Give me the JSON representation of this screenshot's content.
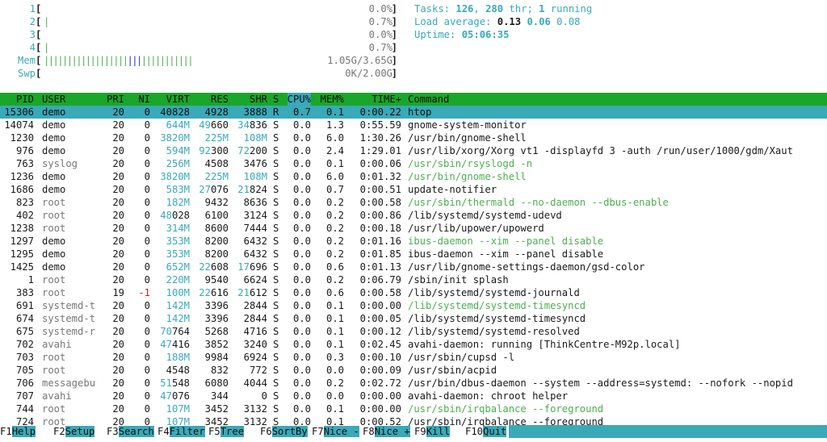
{
  "meters": [
    {
      "label": "1",
      "bars": "",
      "value": "0.0%"
    },
    {
      "label": "2",
      "bars": "|",
      "value": "0.7%"
    },
    {
      "label": "3",
      "bars": "",
      "value": "0.0%"
    },
    {
      "label": "4",
      "bars": "|",
      "value": "0.7%"
    },
    {
      "label": "Mem",
      "bars": "||||||||||||||||||||||||||||||||",
      "value": "1.05G/3.65G"
    },
    {
      "label": "Swp",
      "bars": "",
      "value": "0K/2.00G"
    }
  ],
  "stats": {
    "tasks_label": "Tasks: ",
    "tasks": "126",
    "thr": "280",
    "thr_label": " thr; ",
    "running": "1",
    "running_label": " running",
    "load_label": "Load average: ",
    "load1": "0.13",
    "load5": "0.06",
    "load15": "0.08",
    "uptime_label": "Uptime: ",
    "uptime": "05:06:35"
  },
  "columns": {
    "pid": "PID",
    "user": "USER",
    "pri": "PRI",
    "ni": "NI",
    "virt": "VIRT",
    "res": "RES",
    "shr": "SHR",
    "s": "S",
    "cpu": "CPU%",
    "mem": "MEM%",
    "time": "TIME+",
    "cmd": "Command"
  },
  "processes": [
    {
      "pid": "15306",
      "user": "demo",
      "pri": "20",
      "ni": "0",
      "virt": "40828",
      "res": "4928",
      "shr": "3888",
      "s": "R",
      "cpu": "0.7",
      "mem": "0.1",
      "time": "0:00.22",
      "cmd": "htop",
      "selected": true
    },
    {
      "pid": "14074",
      "user": "demo",
      "pri": "20",
      "ni": "0",
      "virt": "644M",
      "res": "49660",
      "shr": "34836",
      "s": "S",
      "cpu": "0.0",
      "mem": "1.3",
      "time": "0:55.59",
      "cmd": "gnome-system-monitor"
    },
    {
      "pid": "1230",
      "user": "demo",
      "pri": "20",
      "ni": "0",
      "virt": "3820M",
      "res": "225M",
      "shr": "108M",
      "s": "S",
      "cpu": "0.0",
      "mem": "6.0",
      "time": "1:30.26",
      "cmd": "/usr/bin/gnome-shell"
    },
    {
      "pid": "976",
      "user": "demo",
      "pri": "20",
      "ni": "0",
      "virt": "594M",
      "res": "92300",
      "shr": "72200",
      "s": "S",
      "cpu": "0.0",
      "mem": "2.4",
      "time": "1:29.01",
      "cmd": "/usr/lib/xorg/Xorg vt1 -displayfd 3 -auth /run/user/1000/gdm/Xaut"
    },
    {
      "pid": "763",
      "user": "syslog",
      "pri": "20",
      "ni": "0",
      "virt": "256M",
      "res": "4508",
      "shr": "3476",
      "s": "S",
      "cpu": "0.0",
      "mem": "0.1",
      "time": "0:00.06",
      "cmd": "/usr/sbin/rsyslogd -n",
      "thread": true
    },
    {
      "pid": "1236",
      "user": "demo",
      "pri": "20",
      "ni": "0",
      "virt": "3820M",
      "res": "225M",
      "shr": "108M",
      "s": "S",
      "cpu": "0.0",
      "mem": "6.0",
      "time": "0:01.32",
      "cmd": "/usr/bin/gnome-shell",
      "thread": true
    },
    {
      "pid": "1686",
      "user": "demo",
      "pri": "20",
      "ni": "0",
      "virt": "583M",
      "res": "27076",
      "shr": "21824",
      "s": "S",
      "cpu": "0.0",
      "mem": "0.7",
      "time": "0:00.51",
      "cmd": "update-notifier"
    },
    {
      "pid": "823",
      "user": "root",
      "pri": "20",
      "ni": "0",
      "virt": "182M",
      "res": "9432",
      "shr": "8636",
      "s": "S",
      "cpu": "0.0",
      "mem": "0.2",
      "time": "0:00.58",
      "cmd": "/usr/sbin/thermald --no-daemon --dbus-enable",
      "thread": true
    },
    {
      "pid": "402",
      "user": "root",
      "pri": "20",
      "ni": "0",
      "virt": "48028",
      "res": "6100",
      "shr": "3124",
      "s": "S",
      "cpu": "0.0",
      "mem": "0.2",
      "time": "0:00.86",
      "cmd": "/lib/systemd/systemd-udevd"
    },
    {
      "pid": "1238",
      "user": "root",
      "pri": "20",
      "ni": "0",
      "virt": "314M",
      "res": "8600",
      "shr": "7444",
      "s": "S",
      "cpu": "0.0",
      "mem": "0.2",
      "time": "0:00.18",
      "cmd": "/usr/lib/upower/upowerd"
    },
    {
      "pid": "1297",
      "user": "demo",
      "pri": "20",
      "ni": "0",
      "virt": "353M",
      "res": "8200",
      "shr": "6432",
      "s": "S",
      "cpu": "0.0",
      "mem": "0.2",
      "time": "0:01.16",
      "cmd": "ibus-daemon --xim --panel disable",
      "thread": true
    },
    {
      "pid": "1295",
      "user": "demo",
      "pri": "20",
      "ni": "0",
      "virt": "353M",
      "res": "8200",
      "shr": "6432",
      "s": "S",
      "cpu": "0.0",
      "mem": "0.2",
      "time": "0:01.85",
      "cmd": "ibus-daemon --xim --panel disable"
    },
    {
      "pid": "1425",
      "user": "demo",
      "pri": "20",
      "ni": "0",
      "virt": "652M",
      "res": "22608",
      "shr": "17696",
      "s": "S",
      "cpu": "0.0",
      "mem": "0.6",
      "time": "0:01.13",
      "cmd": "/usr/lib/gnome-settings-daemon/gsd-color"
    },
    {
      "pid": "1",
      "user": "root",
      "pri": "20",
      "ni": "0",
      "virt": "220M",
      "res": "9540",
      "shr": "6624",
      "s": "S",
      "cpu": "0.0",
      "mem": "0.2",
      "time": "0:06.79",
      "cmd": "/sbin/init splash"
    },
    {
      "pid": "383",
      "user": "root",
      "pri": "19",
      "ni": "-1",
      "virt": "100M",
      "res": "22616",
      "shr": "21612",
      "s": "S",
      "cpu": "0.0",
      "mem": "0.6",
      "time": "0:00.58",
      "cmd": "/lib/systemd/systemd-journald"
    },
    {
      "pid": "691",
      "user": "systemd-t",
      "pri": "20",
      "ni": "0",
      "virt": "142M",
      "res": "3396",
      "shr": "2844",
      "s": "S",
      "cpu": "0.0",
      "mem": "0.1",
      "time": "0:00.00",
      "cmd": "/lib/systemd/systemd-timesyncd",
      "thread": true
    },
    {
      "pid": "674",
      "user": "systemd-t",
      "pri": "20",
      "ni": "0",
      "virt": "142M",
      "res": "3396",
      "shr": "2844",
      "s": "S",
      "cpu": "0.0",
      "mem": "0.1",
      "time": "0:00.05",
      "cmd": "/lib/systemd/systemd-timesyncd"
    },
    {
      "pid": "675",
      "user": "systemd-r",
      "pri": "20",
      "ni": "0",
      "virt": "70764",
      "res": "5268",
      "shr": "4716",
      "s": "S",
      "cpu": "0.0",
      "mem": "0.1",
      "time": "0:00.12",
      "cmd": "/lib/systemd/systemd-resolved"
    },
    {
      "pid": "702",
      "user": "avahi",
      "pri": "20",
      "ni": "0",
      "virt": "47416",
      "res": "3852",
      "shr": "3240",
      "s": "S",
      "cpu": "0.0",
      "mem": "0.1",
      "time": "0:02.45",
      "cmd": "avahi-daemon: running [ThinkCentre-M92p.local]"
    },
    {
      "pid": "703",
      "user": "root",
      "pri": "20",
      "ni": "0",
      "virt": "188M",
      "res": "9984",
      "shr": "6924",
      "s": "S",
      "cpu": "0.0",
      "mem": "0.3",
      "time": "0:00.10",
      "cmd": "/usr/sbin/cupsd -l"
    },
    {
      "pid": "705",
      "user": "root",
      "pri": "20",
      "ni": "0",
      "virt": "4548",
      "res": "832",
      "shr": "772",
      "s": "S",
      "cpu": "0.0",
      "mem": "0.0",
      "time": "0:00.09",
      "cmd": "/usr/sbin/acpid"
    },
    {
      "pid": "706",
      "user": "messagebu",
      "pri": "20",
      "ni": "0",
      "virt": "51548",
      "res": "6080",
      "shr": "4044",
      "s": "S",
      "cpu": "0.0",
      "mem": "0.2",
      "time": "0:02.72",
      "cmd": "/usr/bin/dbus-daemon --system --address=systemd: --nofork --nopid"
    },
    {
      "pid": "707",
      "user": "avahi",
      "pri": "20",
      "ni": "0",
      "virt": "47076",
      "res": "344",
      "shr": "0",
      "s": "S",
      "cpu": "0.0",
      "mem": "0.0",
      "time": "0:00.00",
      "cmd": "avahi-daemon: chroot helper"
    },
    {
      "pid": "744",
      "user": "root",
      "pri": "20",
      "ni": "0",
      "virt": "107M",
      "res": "3452",
      "shr": "3132",
      "s": "S",
      "cpu": "0.0",
      "mem": "0.1",
      "time": "0:00.00",
      "cmd": "/usr/sbin/irqbalance --foreground",
      "thread": true
    },
    {
      "pid": "724",
      "user": "root",
      "pri": "20",
      "ni": "0",
      "virt": "107M",
      "res": "3452",
      "shr": "3132",
      "s": "S",
      "cpu": "0.0",
      "mem": "0.1",
      "time": "0:00.52",
      "cmd": "/usr/sbin/irqbalance --foreground"
    }
  ],
  "fkeys": [
    {
      "key": "F1",
      "label": "Help"
    },
    {
      "key": "F2",
      "label": "Setup"
    },
    {
      "key": "F3",
      "label": "Search"
    },
    {
      "key": "F4",
      "label": "Filter"
    },
    {
      "key": "F5",
      "label": "Tree"
    },
    {
      "key": "F6",
      "label": "SortBy"
    },
    {
      "key": "F7",
      "label": "Nice -"
    },
    {
      "key": "F8",
      "label": "Nice +"
    },
    {
      "key": "F9",
      "label": "Kill"
    },
    {
      "key": "F10",
      "label": "Quit"
    }
  ],
  "colors": {
    "header_bg": "#1aa629",
    "selected_bg": "#3aa9b8",
    "cyan": "#3aa9b8",
    "green": "#4caf50",
    "red": "#d21f1f"
  }
}
